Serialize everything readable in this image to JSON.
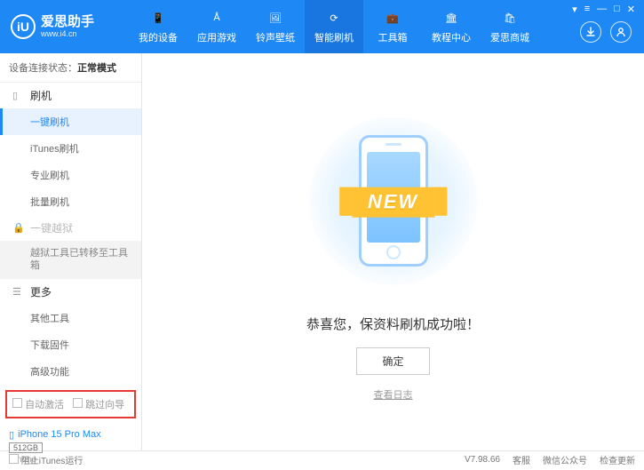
{
  "header": {
    "logo_letter": "iU",
    "app_name": "爱思助手",
    "app_url": "www.i4.cn",
    "window_controls": [
      "▾",
      "≡",
      "—",
      "□",
      "✕"
    ]
  },
  "nav": [
    {
      "label": "我的设备",
      "icon": "📱"
    },
    {
      "label": "应用游戏",
      "icon": "Å"
    },
    {
      "label": "铃声壁纸",
      "icon": "🖼"
    },
    {
      "label": "智能刷机",
      "icon": "⟳",
      "active": true
    },
    {
      "label": "工具箱",
      "icon": "💼"
    },
    {
      "label": "教程中心",
      "icon": "🏛"
    },
    {
      "label": "爱思商城",
      "icon": "🛍"
    }
  ],
  "status": {
    "label": "设备连接状态：",
    "mode": "正常模式"
  },
  "sidebar": {
    "flash": {
      "title": "刷机",
      "items": [
        "一键刷机",
        "iTunes刷机",
        "专业刷机",
        "批量刷机"
      ]
    },
    "jailbreak": {
      "title": "一键越狱",
      "note": "越狱工具已转移至工具箱"
    },
    "more": {
      "title": "更多",
      "items": [
        "其他工具",
        "下载固件",
        "高级功能"
      ]
    }
  },
  "checkboxes": {
    "auto_activate": "自动激活",
    "skip_guide": "跳过向导"
  },
  "device": {
    "name": "iPhone 15 Pro Max",
    "storage": "512GB",
    "type": "iPhone"
  },
  "main": {
    "new_text": "NEW",
    "success": "恭喜您，保资料刷机成功啦！",
    "ok": "确定",
    "view_log": "查看日志"
  },
  "footer": {
    "block_itunes": "阻止iTunes运行",
    "version": "V7.98.66",
    "links": [
      "客服",
      "微信公众号",
      "检查更新"
    ]
  }
}
